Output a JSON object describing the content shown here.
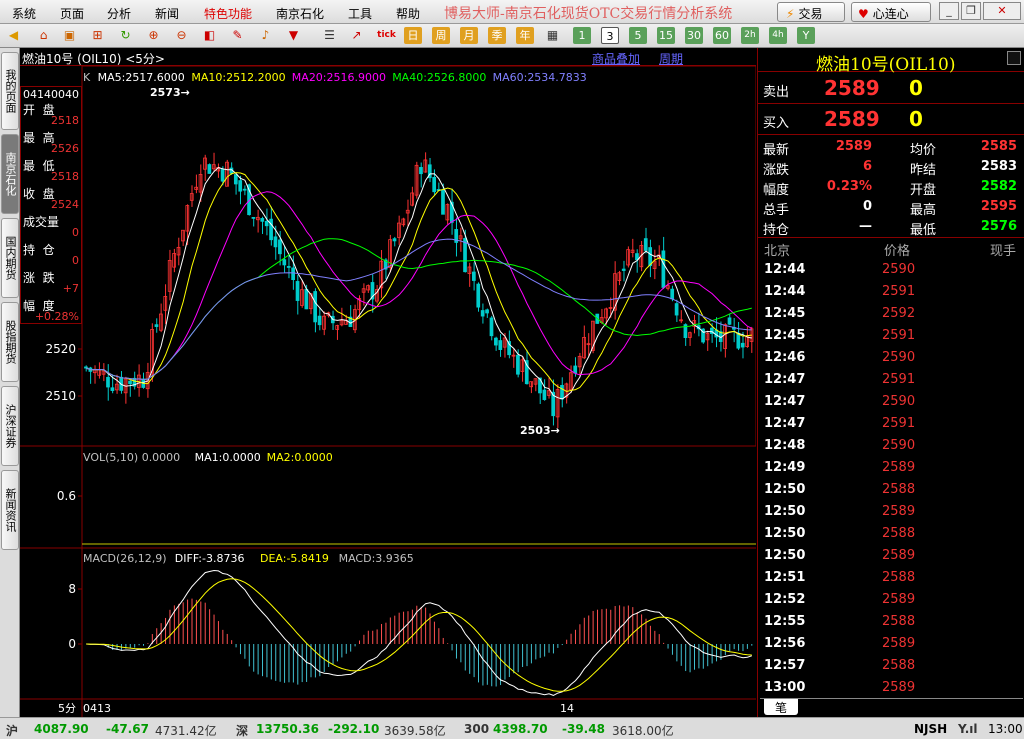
{
  "menu": [
    "系统",
    "页面",
    "分析",
    "新闻",
    "特色功能",
    "南京石化",
    "工具",
    "帮助"
  ],
  "app_title": "博易大师-南京石化现货OTC交易行情分析系统",
  "trade_button": "交易",
  "heart_button": "心连心",
  "toolbar_periods": [
    "1",
    "3",
    "5",
    "15",
    "30",
    "60",
    "2h",
    "4h",
    "Y"
  ],
  "toolbar_labels": {
    "tick": "tick",
    "day": "日",
    "week": "周",
    "month": "月",
    "season": "季",
    "year": "年"
  },
  "left_tabs": [
    "我的页面",
    "南京石化",
    "国内期货",
    "股指期货",
    "沪深证券",
    "新闻资讯"
  ],
  "chart": {
    "header": "燃油10号 (OIL10) <5分>",
    "link_overlay": "商品叠加",
    "link_period": "周期",
    "ma_legend": [
      {
        "text": "K",
        "color": "#c0c0c0"
      },
      {
        "text": "MA5:2517.6000",
        "color": "#ffffff"
      },
      {
        "text": "MA10:2512.2000",
        "color": "#ffff00"
      },
      {
        "text": "MA20:2516.9000",
        "color": "#ff00ff"
      },
      {
        "text": "MA40:2526.8000",
        "color": "#00ff00"
      },
      {
        "text": "MA60:2534.7833",
        "color": "#8080ff"
      }
    ],
    "high_mark": "2573",
    "low_mark": "2503",
    "price_axis": [
      "2520",
      "2510"
    ],
    "vol_legend": [
      {
        "text": "VOL(5,10) 0.0000",
        "color": "#c0c0c0"
      },
      {
        "text": "MA1:0.0000",
        "color": "#ffffff"
      },
      {
        "text": "MA2:0.0000",
        "color": "#ffff00"
      }
    ],
    "vol_axis": [
      "0.6"
    ],
    "macd_legend": [
      {
        "text": "MACD(26,12,9)",
        "color": "#c0c0c0"
      },
      {
        "text": "DIFF:-3.8736",
        "color": "#ffffff"
      },
      {
        "text": "DEA:-5.8419",
        "color": "#ffff00"
      },
      {
        "text": "MACD:3.9365",
        "color": "#c0c0c0"
      }
    ],
    "macd_axis": [
      "8",
      "0"
    ],
    "period_label": "5分",
    "date_labels": [
      "0413",
      "14"
    ]
  },
  "info_box": {
    "time": "04140040",
    "rows": [
      {
        "label": "开  盘",
        "value": "2518"
      },
      {
        "label": "最  高",
        "value": "2526"
      },
      {
        "label": "最  低",
        "value": "2518"
      },
      {
        "label": "收  盘",
        "value": "2524"
      },
      {
        "label": "成交量",
        "value": "0"
      },
      {
        "label": "持  仓",
        "value": "0"
      },
      {
        "label": "涨  跌",
        "value": "+7"
      },
      {
        "label": "幅  度",
        "value": "+0.28%"
      }
    ]
  },
  "quote": {
    "title": "燃油10号(OIL10)",
    "sell_label": "卖出",
    "sell_price": "2589",
    "sell_qty": "0",
    "buy_label": "买入",
    "buy_price": "2589",
    "buy_qty": "0",
    "stats_left": [
      {
        "label": "最新",
        "value": "2589",
        "color": "#ff3333"
      },
      {
        "label": "涨跌",
        "value": "6",
        "color": "#ff3333"
      },
      {
        "label": "幅度",
        "value": "0.23%",
        "color": "#ff3333"
      },
      {
        "label": "总手",
        "value": "0",
        "color": "#ffffff"
      },
      {
        "label": "持仓",
        "value": "—",
        "color": "#ffffff"
      }
    ],
    "stats_right": [
      {
        "label": "均价",
        "value": "2585",
        "color": "#ff3333"
      },
      {
        "label": "昨结",
        "value": "2583",
        "color": "#ffffff"
      },
      {
        "label": "开盘",
        "value": "2582",
        "color": "#00ff00"
      },
      {
        "label": "最高",
        "value": "2595",
        "color": "#ff3333"
      },
      {
        "label": "最低",
        "value": "2576",
        "color": "#00ff00"
      }
    ],
    "ticks_header": {
      "time": "北京",
      "price": "价格",
      "qty": "现手"
    },
    "ticks": [
      {
        "time": "12:44",
        "price": "2590"
      },
      {
        "time": "12:44",
        "price": "2591"
      },
      {
        "time": "12:45",
        "price": "2592"
      },
      {
        "time": "12:45",
        "price": "2591"
      },
      {
        "time": "12:46",
        "price": "2590"
      },
      {
        "time": "12:47",
        "price": "2591"
      },
      {
        "time": "12:47",
        "price": "2590"
      },
      {
        "time": "12:47",
        "price": "2591"
      },
      {
        "time": "12:48",
        "price": "2590"
      },
      {
        "time": "12:49",
        "price": "2589"
      },
      {
        "time": "12:50",
        "price": "2588"
      },
      {
        "time": "12:50",
        "price": "2589"
      },
      {
        "time": "12:50",
        "price": "2588"
      },
      {
        "time": "12:50",
        "price": "2589"
      },
      {
        "time": "12:51",
        "price": "2588"
      },
      {
        "time": "12:52",
        "price": "2589"
      },
      {
        "time": "12:55",
        "price": "2588"
      },
      {
        "time": "12:56",
        "price": "2589"
      },
      {
        "time": "12:57",
        "price": "2588"
      },
      {
        "time": "13:00",
        "price": "2589"
      }
    ],
    "tab_label": "笔"
  },
  "statusbar": {
    "sh_label": "沪",
    "sh_index": "4087.90",
    "sh_change": "-47.67",
    "sh_amount": "4731.42亿",
    "sz_label": "深",
    "sz_index": "13750.36",
    "sz_change": "-292.10",
    "sz_amount": "3639.58亿",
    "hs_label": "300",
    "hs_index": "4398.70",
    "hs_change": "-39.48",
    "hs_amount": "3618.00亿",
    "server": "NJSH",
    "clock": "13:00"
  },
  "colors": {
    "up": "#ff3333",
    "down": "#00cccc",
    "grid": "#800000",
    "text_red": "#ff3333",
    "text_green": "#00ff00"
  }
}
